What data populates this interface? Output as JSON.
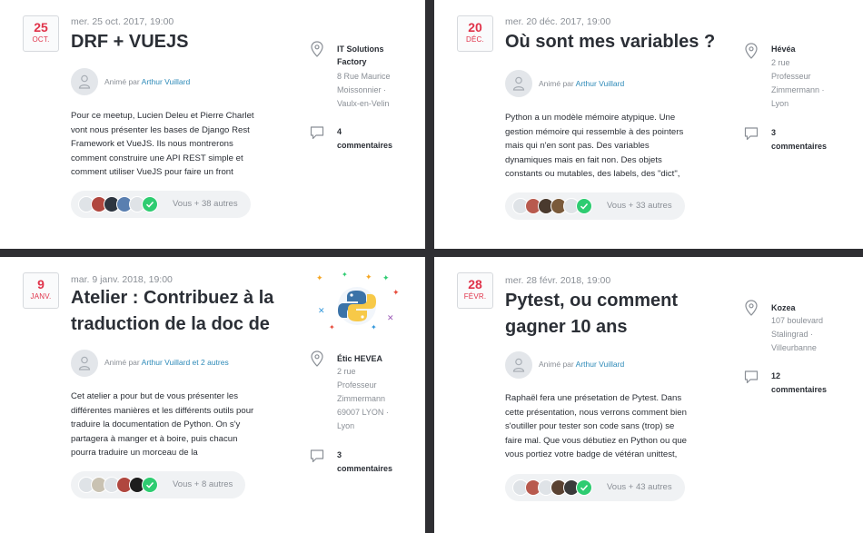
{
  "events": [
    {
      "day": "25",
      "month": "OCT.",
      "datetime": "mer. 25 oct. 2017, 19:00",
      "title_lines": [
        "DRF + VUEJS"
      ],
      "host_prefix": "Animé par",
      "host_name": "Arthur Vuillard",
      "description_lines": [
        "Pour ce meetup, Lucien Deleu et Pierre Charlet",
        "vont nous présenter les bases de Django Rest",
        "Framework et VueJS. Ils nous montrerons",
        "comment construire une API REST simple et",
        "comment utiliser VueJS pour faire un front"
      ],
      "venue_name_lines": [
        "IT Solutions",
        "Factory"
      ],
      "venue_addr_lines": [
        "8 Rue Maurice",
        "Moissonnier ·",
        "Vaulx-en-Velin"
      ],
      "comments_count": "4",
      "comments_label": "commentaires",
      "attendees_text": "Vous + 38 autres"
    },
    {
      "day": "20",
      "month": "DÉC.",
      "datetime": "mer. 20 déc. 2017, 19:00",
      "title_lines": [
        "Où sont mes variables ?"
      ],
      "host_prefix": "Animé par",
      "host_name": "Arthur Vuillard",
      "description_lines": [
        "Python a un modèle mémoire atypique. Une",
        "gestion mémoire qui ressemble à des pointers",
        "mais qui n'en sont pas. Des variables",
        "dynamiques mais en fait non. Des objets",
        "constants ou mutables, des labels, des \"dict\","
      ],
      "venue_name_lines": [
        "Hévéa"
      ],
      "venue_addr_lines": [
        "2 rue",
        "Professeur",
        "Zimmermann ·",
        "Lyon"
      ],
      "comments_count": "3",
      "comments_label": "commentaires",
      "attendees_text": "Vous + 33 autres"
    },
    {
      "day": "9",
      "month": "JANV.",
      "datetime": "mar. 9 janv. 2018, 19:00",
      "title_lines": [
        "Atelier : Contribuez à la",
        "traduction de la doc de"
      ],
      "host_prefix": "Animé par",
      "host_name": "Arthur Vuillard et 2 autres",
      "description_lines": [
        "Cet atelier a pour but de vous présenter les",
        "différentes manières et les différents outils pour",
        "traduire la documentation de Python. On s'y",
        "partagera à manger et à boire, puis chacun",
        "pourra traduire un morceau de la"
      ],
      "venue_name_lines": [
        "Étic HEVEA"
      ],
      "venue_addr_lines": [
        "2 rue",
        "Professeur",
        "Zimmermann",
        "69007 LYON ·",
        "Lyon"
      ],
      "comments_count": "3",
      "comments_label": "commentaires",
      "attendees_text": "Vous + 8 autres"
    },
    {
      "day": "28",
      "month": "FÉVR.",
      "datetime": "mer. 28 févr. 2018, 19:00",
      "title_lines": [
        "Pytest, ou comment",
        "gagner 10 ans"
      ],
      "host_prefix": "Animé par",
      "host_name": "Arthur Vuillard",
      "description_lines": [
        "Raphaël fera une présetation de Pytest. Dans",
        "cette présentation, nous verrons comment bien",
        "s'outiller pour tester son code sans (trop) se",
        "faire mal. Que vous débutiez en Python ou que",
        "vous portiez votre badge de vétéran unittest,"
      ],
      "venue_name_lines": [
        "Kozea"
      ],
      "venue_addr_lines": [
        "107 boulevard",
        "Stalingrad ·",
        "Villeurbanne"
      ],
      "comments_count": "12",
      "comments_label": "commentaires",
      "attendees_text": "Vous + 43 autres"
    }
  ],
  "colors": {
    "date_red": "#e0334a",
    "link_blue": "#2d8ab8",
    "going_green": "#2ecc71",
    "separator": "#2f2f33"
  },
  "icons": [
    "location-pin-icon",
    "comment-bubble-icon",
    "user-placeholder-icon",
    "checkmark-icon",
    "python-logo-icon"
  ]
}
